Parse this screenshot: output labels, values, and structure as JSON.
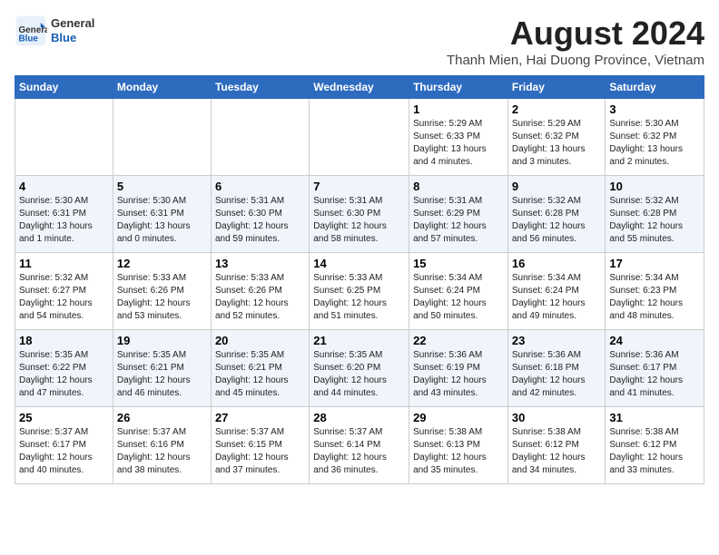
{
  "header": {
    "logo_line1": "General",
    "logo_line2": "Blue",
    "title": "August 2024",
    "subtitle": "Thanh Mien, Hai Duong Province, Vietnam"
  },
  "weekdays": [
    "Sunday",
    "Monday",
    "Tuesday",
    "Wednesday",
    "Thursday",
    "Friday",
    "Saturday"
  ],
  "weeks": [
    [
      {
        "day": "",
        "info": ""
      },
      {
        "day": "",
        "info": ""
      },
      {
        "day": "",
        "info": ""
      },
      {
        "day": "",
        "info": ""
      },
      {
        "day": "1",
        "info": "Sunrise: 5:29 AM\nSunset: 6:33 PM\nDaylight: 13 hours\nand 4 minutes."
      },
      {
        "day": "2",
        "info": "Sunrise: 5:29 AM\nSunset: 6:32 PM\nDaylight: 13 hours\nand 3 minutes."
      },
      {
        "day": "3",
        "info": "Sunrise: 5:30 AM\nSunset: 6:32 PM\nDaylight: 13 hours\nand 2 minutes."
      }
    ],
    [
      {
        "day": "4",
        "info": "Sunrise: 5:30 AM\nSunset: 6:31 PM\nDaylight: 13 hours\nand 1 minute."
      },
      {
        "day": "5",
        "info": "Sunrise: 5:30 AM\nSunset: 6:31 PM\nDaylight: 13 hours\nand 0 minutes."
      },
      {
        "day": "6",
        "info": "Sunrise: 5:31 AM\nSunset: 6:30 PM\nDaylight: 12 hours\nand 59 minutes."
      },
      {
        "day": "7",
        "info": "Sunrise: 5:31 AM\nSunset: 6:30 PM\nDaylight: 12 hours\nand 58 minutes."
      },
      {
        "day": "8",
        "info": "Sunrise: 5:31 AM\nSunset: 6:29 PM\nDaylight: 12 hours\nand 57 minutes."
      },
      {
        "day": "9",
        "info": "Sunrise: 5:32 AM\nSunset: 6:28 PM\nDaylight: 12 hours\nand 56 minutes."
      },
      {
        "day": "10",
        "info": "Sunrise: 5:32 AM\nSunset: 6:28 PM\nDaylight: 12 hours\nand 55 minutes."
      }
    ],
    [
      {
        "day": "11",
        "info": "Sunrise: 5:32 AM\nSunset: 6:27 PM\nDaylight: 12 hours\nand 54 minutes."
      },
      {
        "day": "12",
        "info": "Sunrise: 5:33 AM\nSunset: 6:26 PM\nDaylight: 12 hours\nand 53 minutes."
      },
      {
        "day": "13",
        "info": "Sunrise: 5:33 AM\nSunset: 6:26 PM\nDaylight: 12 hours\nand 52 minutes."
      },
      {
        "day": "14",
        "info": "Sunrise: 5:33 AM\nSunset: 6:25 PM\nDaylight: 12 hours\nand 51 minutes."
      },
      {
        "day": "15",
        "info": "Sunrise: 5:34 AM\nSunset: 6:24 PM\nDaylight: 12 hours\nand 50 minutes."
      },
      {
        "day": "16",
        "info": "Sunrise: 5:34 AM\nSunset: 6:24 PM\nDaylight: 12 hours\nand 49 minutes."
      },
      {
        "day": "17",
        "info": "Sunrise: 5:34 AM\nSunset: 6:23 PM\nDaylight: 12 hours\nand 48 minutes."
      }
    ],
    [
      {
        "day": "18",
        "info": "Sunrise: 5:35 AM\nSunset: 6:22 PM\nDaylight: 12 hours\nand 47 minutes."
      },
      {
        "day": "19",
        "info": "Sunrise: 5:35 AM\nSunset: 6:21 PM\nDaylight: 12 hours\nand 46 minutes."
      },
      {
        "day": "20",
        "info": "Sunrise: 5:35 AM\nSunset: 6:21 PM\nDaylight: 12 hours\nand 45 minutes."
      },
      {
        "day": "21",
        "info": "Sunrise: 5:35 AM\nSunset: 6:20 PM\nDaylight: 12 hours\nand 44 minutes."
      },
      {
        "day": "22",
        "info": "Sunrise: 5:36 AM\nSunset: 6:19 PM\nDaylight: 12 hours\nand 43 minutes."
      },
      {
        "day": "23",
        "info": "Sunrise: 5:36 AM\nSunset: 6:18 PM\nDaylight: 12 hours\nand 42 minutes."
      },
      {
        "day": "24",
        "info": "Sunrise: 5:36 AM\nSunset: 6:17 PM\nDaylight: 12 hours\nand 41 minutes."
      }
    ],
    [
      {
        "day": "25",
        "info": "Sunrise: 5:37 AM\nSunset: 6:17 PM\nDaylight: 12 hours\nand 40 minutes."
      },
      {
        "day": "26",
        "info": "Sunrise: 5:37 AM\nSunset: 6:16 PM\nDaylight: 12 hours\nand 38 minutes."
      },
      {
        "day": "27",
        "info": "Sunrise: 5:37 AM\nSunset: 6:15 PM\nDaylight: 12 hours\nand 37 minutes."
      },
      {
        "day": "28",
        "info": "Sunrise: 5:37 AM\nSunset: 6:14 PM\nDaylight: 12 hours\nand 36 minutes."
      },
      {
        "day": "29",
        "info": "Sunrise: 5:38 AM\nSunset: 6:13 PM\nDaylight: 12 hours\nand 35 minutes."
      },
      {
        "day": "30",
        "info": "Sunrise: 5:38 AM\nSunset: 6:12 PM\nDaylight: 12 hours\nand 34 minutes."
      },
      {
        "day": "31",
        "info": "Sunrise: 5:38 AM\nSunset: 6:12 PM\nDaylight: 12 hours\nand 33 minutes."
      }
    ]
  ]
}
